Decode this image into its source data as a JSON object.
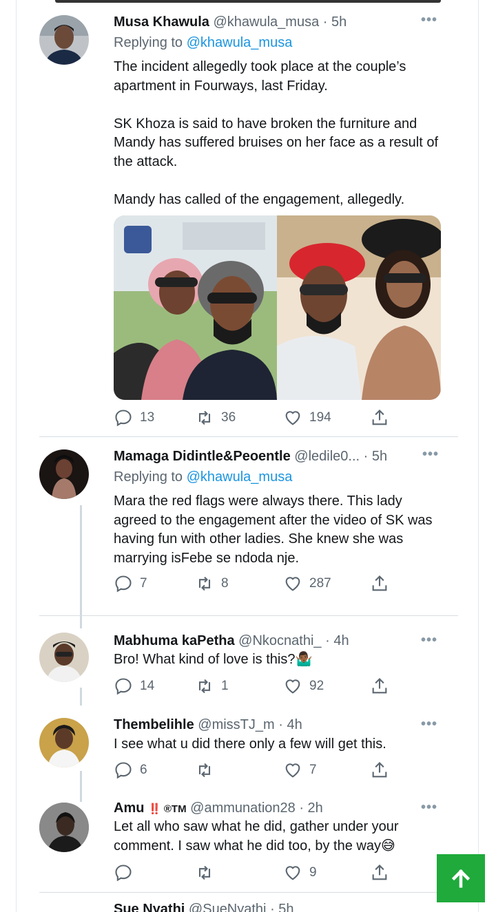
{
  "tweets": [
    {
      "name": "Musa Khawula",
      "handle": "@khawula_musa",
      "time": "· 5h",
      "reply_label": "Replying to",
      "reply_to": "@khawula_musa",
      "body": "The incident allegedly took place at the couple’s apartment in Fourways, last Friday.\n\nSK Khoza is said to have broken the furniture and Mandy has suffered bruises on her face as a result of the attack.\n\nMandy has called of the engagement, allegedly.",
      "replies": "13",
      "retweets": "36",
      "likes": "194"
    },
    {
      "name": "Mamaga Didintle&Peoentle",
      "handle": "@ledile0...",
      "time": "· 5h",
      "reply_label": "Replying to",
      "reply_to": "@khawula_musa",
      "body": "Mara the red flags were always there. This lady agreed to the engagement after the video of SK was having fun with other ladies. She knew she was marrying isFebe se ndoda nje.",
      "replies": "7",
      "retweets": "8",
      "likes": "287"
    },
    {
      "name": "Mabhuma kaPetha",
      "handle": "@Nkocnathi_",
      "time": "· 4h",
      "body": "Bro! What kind of love is this?🤷🏾‍♂️",
      "replies": "14",
      "retweets": "1",
      "likes": "92"
    },
    {
      "name": "Thembelihle",
      "handle": "@missTJ_m",
      "time": "· 4h",
      "body": "I see what u did there only a few will get this.",
      "replies": "6",
      "retweets": "",
      "likes": "7"
    },
    {
      "name": "Amu",
      "name_badge": "‼️ ®TM",
      "handle": "@ammunation28",
      "time": "· 2h",
      "body": "Let all who saw what he did, gather under your comment. I saw what he did too, by the way😅",
      "replies": "",
      "retweets": "",
      "likes": "9"
    },
    {
      "name": "Sue Nyathi",
      "handle": "@SueNyathi",
      "time": "· 5h"
    }
  ],
  "more_glyph": "•••",
  "icons": {
    "reply": "reply-icon",
    "retweet": "retweet-icon",
    "like": "heart-icon",
    "share": "share-icon",
    "scroll_top": "arrow-up-icon"
  },
  "colors": {
    "link": "#1b95e0",
    "meta": "#5b6670",
    "fab": "#1faa3b"
  }
}
